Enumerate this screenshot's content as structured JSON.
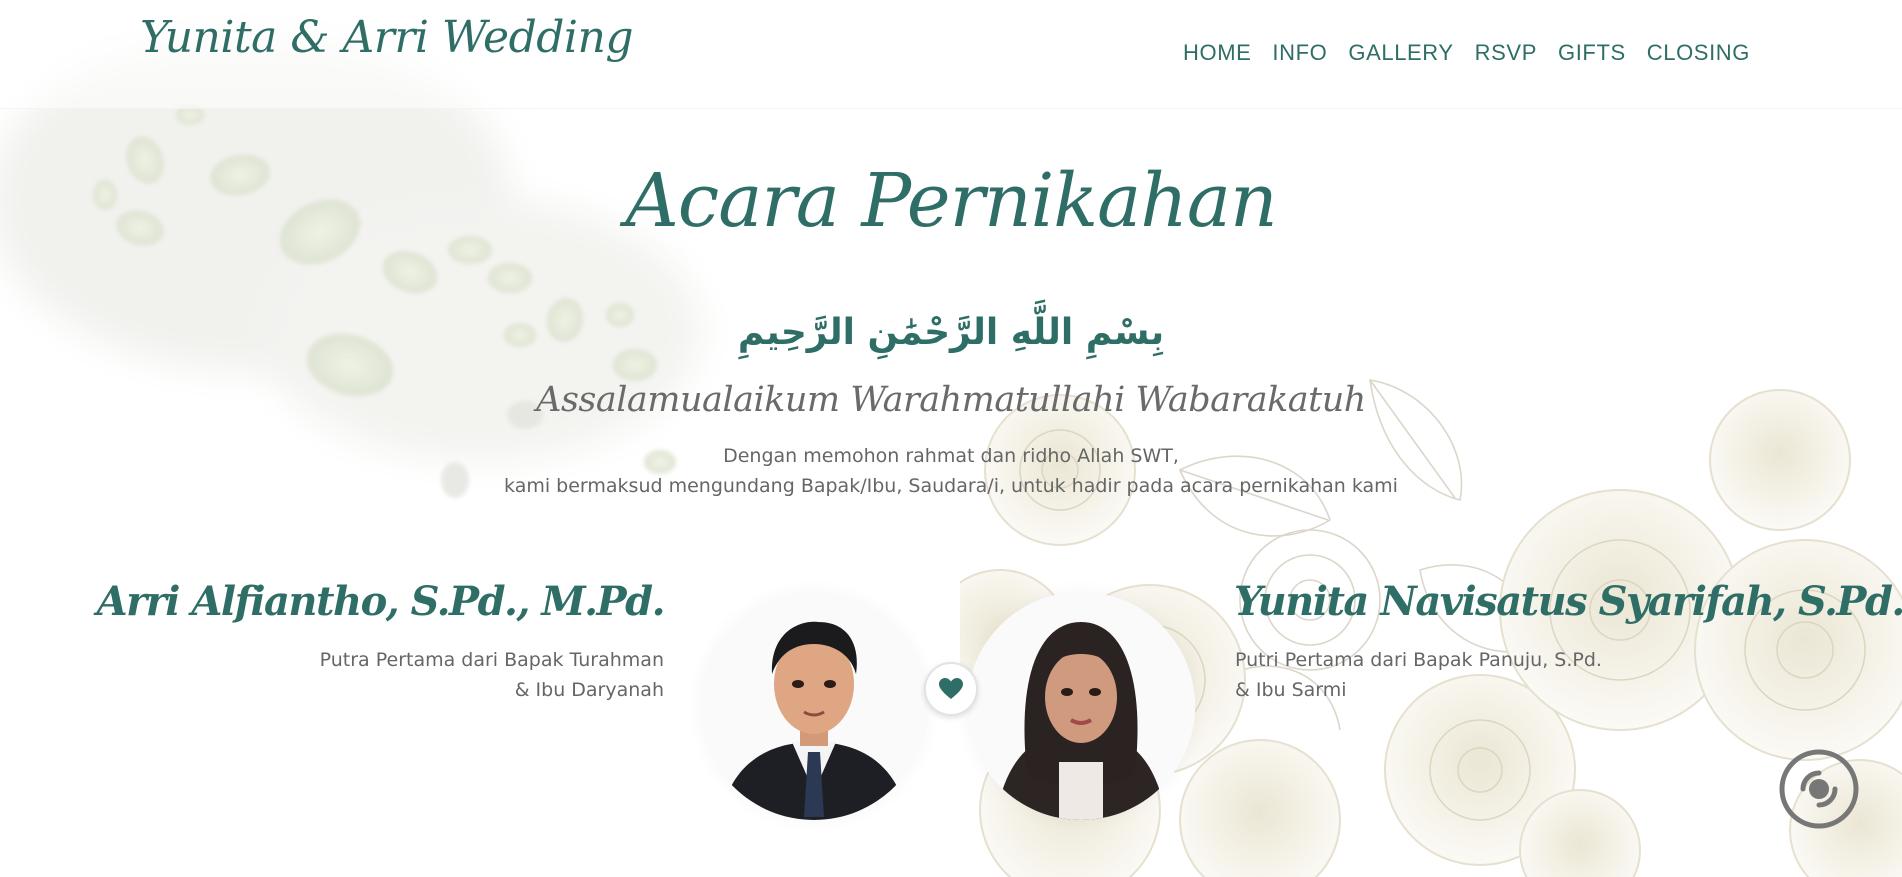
{
  "header": {
    "logo": "Yunita & Arri Wedding",
    "nav": [
      "HOME",
      "INFO",
      "GALLERY",
      "RSVP",
      "GIFTS",
      "CLOSING"
    ]
  },
  "main": {
    "title": "Acara Pernikahan",
    "arabic": "بِسْمِ اللَّهِ الرَّحْمَٰنِ الرَّحِيمِ",
    "greeting": "Assalamualaikum Warahmatullahi Wabarakatuh",
    "intro": [
      "Dengan memohon rahmat dan ridho Allah SWT,",
      "kami bermaksud mengundang Bapak/Ibu, Saudara/i, untuk hadir pada acara pernikahan kami"
    ]
  },
  "groom": {
    "name": "Arri Alfiantho, S.Pd., M.Pd.",
    "parents": [
      "Putra Pertama dari Bapak Turahman",
      "& Ibu Daryanah"
    ]
  },
  "bride": {
    "name": "Yunita Navisatus Syarifah, S.Pd.",
    "parents": [
      "Putri Pertama dari Bapak Panuju, S.Pd.",
      "& Ibu Sarmi"
    ]
  },
  "icons": {
    "heart": "heart-icon",
    "audio": "audio-icon"
  },
  "colors": {
    "accent": "#2f6e66",
    "text": "#666666",
    "rose": "#f3efe3"
  }
}
